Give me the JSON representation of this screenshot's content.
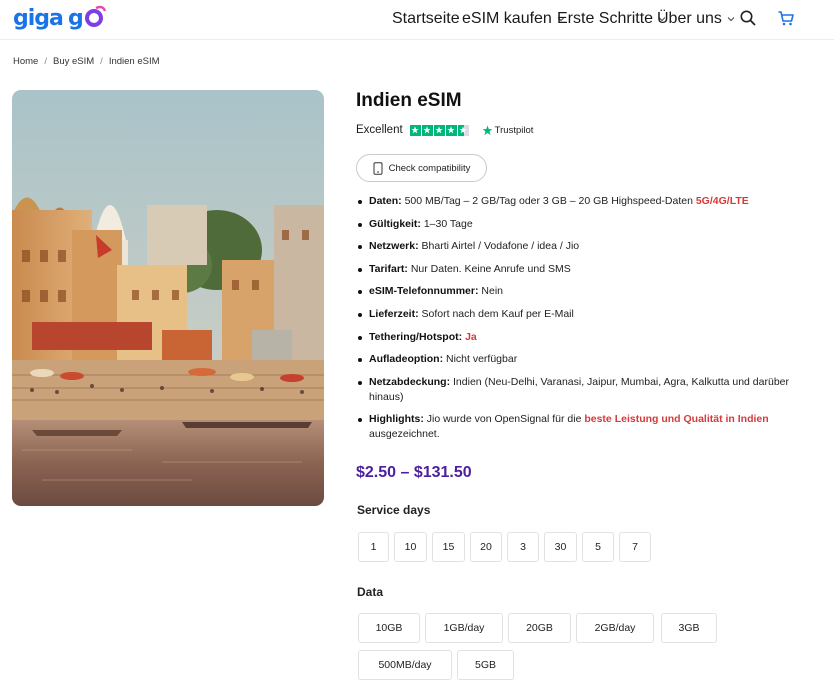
{
  "header": {
    "logo": "gigago",
    "nav": [
      {
        "label": "Startseite",
        "has_menu": false
      },
      {
        "label": "eSIM kaufen",
        "has_menu": true
      },
      {
        "label": "Erste Schritte",
        "has_menu": true
      },
      {
        "label": "Über uns",
        "has_menu": true
      }
    ],
    "icons": [
      "search-icon",
      "cart-icon"
    ]
  },
  "breadcrumb": [
    "Home",
    "Buy eSIM",
    "Indien eSIM"
  ],
  "product": {
    "title": "Indien eSIM",
    "rating_label": "Excellent",
    "trustpilot": "Trustpilot",
    "compat_button": "Check compatibility",
    "specs": [
      {
        "key": "Daten:",
        "value": " 500 MB/Tag – 2 GB/Tag oder 3 GB – 20 GB Highspeed-Daten ",
        "highlight": "5G/4G/LTE",
        "tail": ""
      },
      {
        "key": "Gültigkeit:",
        "value": " 1–30 Tage",
        "highlight": "",
        "tail": ""
      },
      {
        "key": "Netzwerk:",
        "value": " Bharti Airtel / Vodafone / idea / Jio",
        "highlight": "",
        "tail": ""
      },
      {
        "key": "Tarifart:",
        "value": " Nur Daten. Keine Anrufe und SMS",
        "highlight": "",
        "tail": ""
      },
      {
        "key": "eSIM-Telefonnummer:",
        "value": " Nein",
        "highlight": "",
        "tail": ""
      },
      {
        "key": "Lieferzeit:",
        "value": " Sofort nach dem Kauf per E-Mail",
        "highlight": "",
        "tail": ""
      },
      {
        "key": "Tethering/Hotspot:",
        "value": " ",
        "highlight": "Ja",
        "tail": ""
      },
      {
        "key": "Aufladeoption:",
        "value": " Nicht verfügbar",
        "highlight": "",
        "tail": ""
      },
      {
        "key": "Netzabdeckung:",
        "value": " Indien (Neu-Delhi, Varanasi, Jaipur, Mumbai, Agra, Kalkutta und darüber hinaus)",
        "highlight": "",
        "tail": ""
      },
      {
        "key": "Highlights:",
        "value": " Jio wurde von OpenSignal für die ",
        "highlight": "beste Leistung und Qualität in Indien",
        "tail": " ausgezeichnet."
      }
    ],
    "price": "$2.50 – $131.50",
    "service_days_label": "Service days",
    "service_days": [
      "1",
      "10",
      "15",
      "20",
      "3",
      "30",
      "5",
      "7"
    ],
    "data_label": "Data",
    "data_options": [
      "10GB",
      "1GB/day",
      "20GB",
      "2GB/day",
      "3GB",
      "500MB/day",
      "5GB"
    ]
  },
  "colors": {
    "accent": "#4b1f9f",
    "highlight": "#d63a3a",
    "trustpilot_green": "#00b67a",
    "logo_blue": "#1a73e8",
    "cart_blue": "#1a73e8"
  }
}
